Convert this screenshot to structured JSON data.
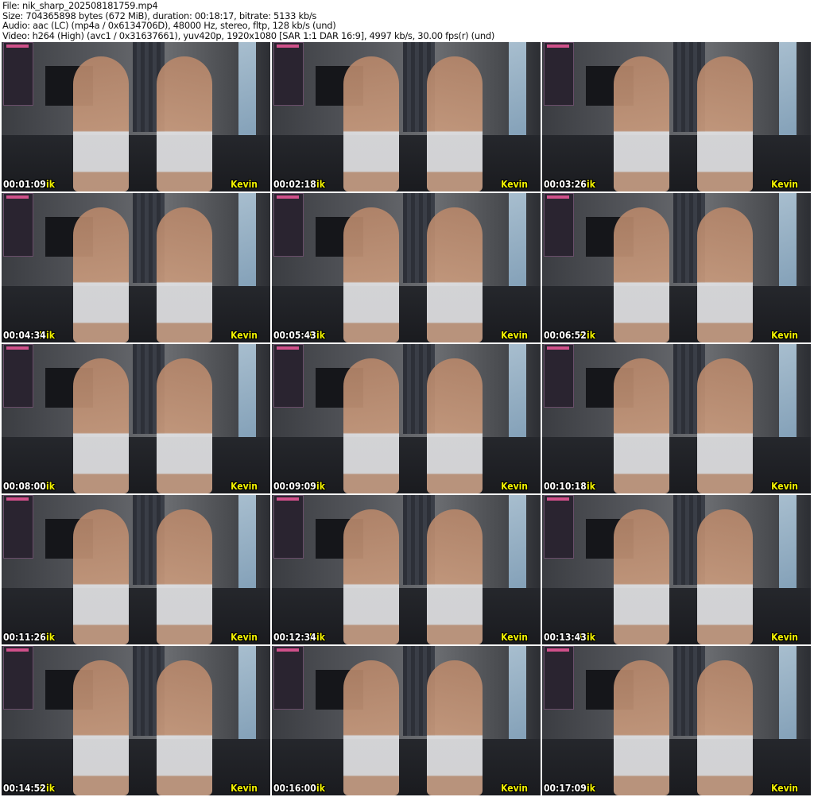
{
  "header": {
    "file": "File: nik_sharp_202508181759.mp4",
    "size": "Size: 704365898 bytes (672 MiB), duration: 00:18:17, bitrate: 5133 kb/s",
    "audio": "Audio: aac (LC) (mp4a / 0x6134706D), 48000 Hz, stereo, fltp, 128 kb/s (und)",
    "video": "Video: h264 (High) (avc1 / 0x31637661), yuv420p, 1920x1080 [SAR 1:1 DAR 16:9], 4997 kb/s, 30.00 fps(r) (und)"
  },
  "labels": {
    "left": "Nik",
    "right": "Kevin"
  },
  "thumbnails": [
    {
      "time": "00:01:09"
    },
    {
      "time": "00:02:18"
    },
    {
      "time": "00:03:26"
    },
    {
      "time": "00:04:34"
    },
    {
      "time": "00:05:43"
    },
    {
      "time": "00:06:52"
    },
    {
      "time": "00:08:00"
    },
    {
      "time": "00:09:09"
    },
    {
      "time": "00:10:18"
    },
    {
      "time": "00:11:26"
    },
    {
      "time": "00:12:34"
    },
    {
      "time": "00:13:43"
    },
    {
      "time": "00:14:52"
    },
    {
      "time": "00:16:00"
    },
    {
      "time": "00:17:09"
    }
  ]
}
